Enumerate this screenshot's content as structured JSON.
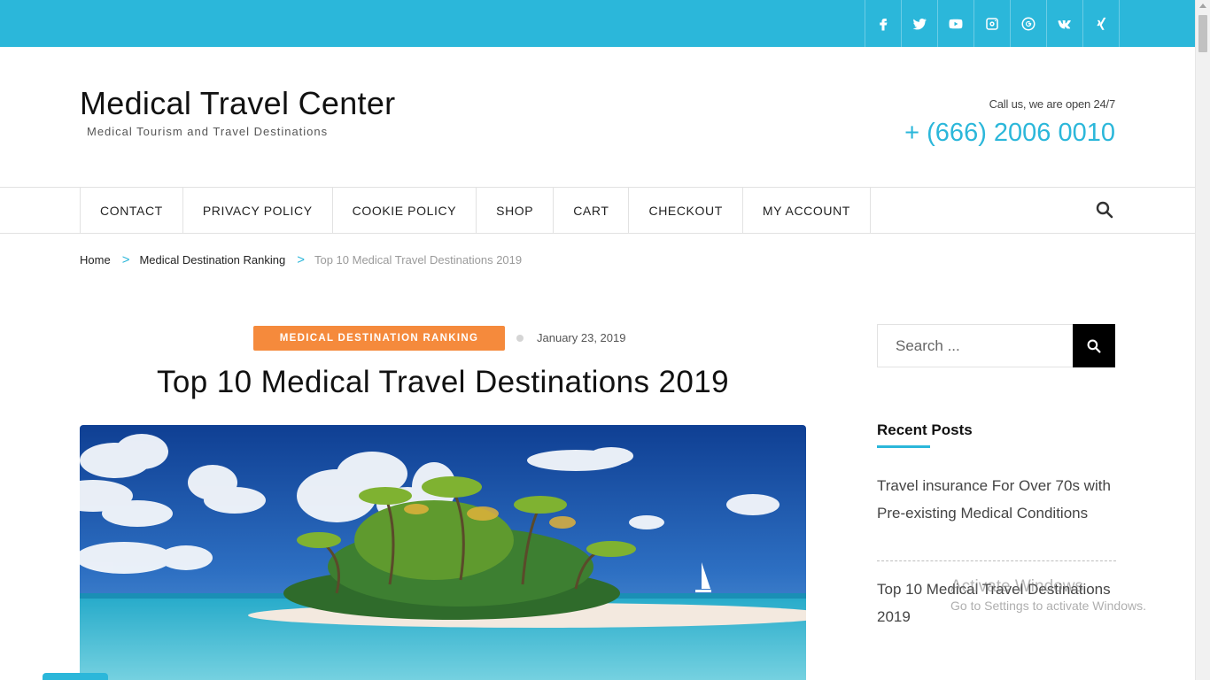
{
  "colors": {
    "accent": "#2bb7da",
    "badge": "#f58a3c"
  },
  "social": [
    {
      "name": "facebook-icon",
      "glyph": "f"
    },
    {
      "name": "twitter-icon"
    },
    {
      "name": "youtube-icon"
    },
    {
      "name": "instagram-icon"
    },
    {
      "name": "google-plus-icon"
    },
    {
      "name": "vk-icon"
    },
    {
      "name": "xing-icon"
    }
  ],
  "header": {
    "title": "Medical Travel Center",
    "tagline": "Medical Tourism and Travel Destinations",
    "call_label": "Call us, we are open 24/7",
    "phone": "+ (666) 2006 0010"
  },
  "nav": {
    "items": [
      "CONTACT",
      "PRIVACY POLICY",
      "COOKIE POLICY",
      "SHOP",
      "CART",
      "CHECKOUT",
      "MY ACCOUNT"
    ]
  },
  "breadcrumb": {
    "home": "Home",
    "sep": ">",
    "category": "Medical Destination Ranking",
    "current": "Top 10 Medical Travel Destinations 2019"
  },
  "post": {
    "category": "MEDICAL DESTINATION RANKING",
    "date": "January 23, 2019",
    "title": "Top 10 Medical Travel Destinations 2019"
  },
  "sidebar": {
    "search_placeholder": "Search ...",
    "widget_title": "Recent Posts",
    "recent_posts": [
      "Travel insurance For Over 70s with Pre-existing Medical Conditions",
      "Top 10 Medical Travel Destinations 2019"
    ]
  },
  "overlay": {
    "activate": "Activate Windows",
    "settings": "Go to Settings to activate Windows."
  }
}
